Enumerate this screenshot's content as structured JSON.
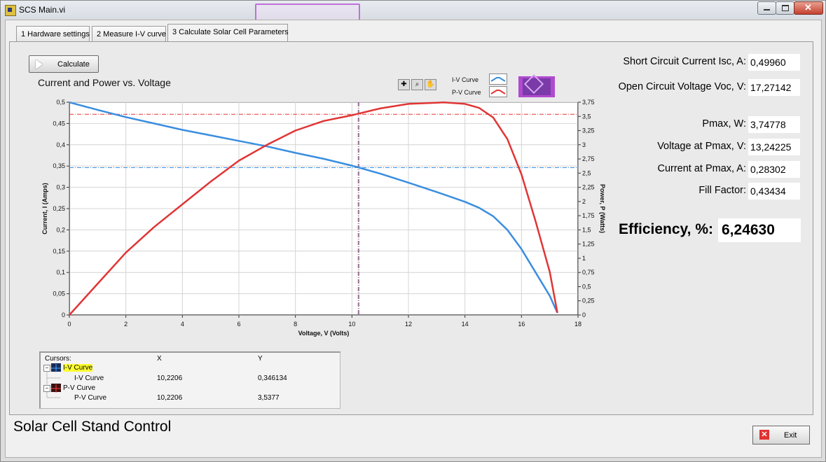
{
  "window": {
    "title": "SCS Main.vi"
  },
  "tabs": [
    {
      "label": "1 Hardware settings"
    },
    {
      "label": "2 Measure I-V curve"
    },
    {
      "label": "3 Calculate Solar Cell Parameters"
    }
  ],
  "toolbar": {
    "calculate_label": "Calculate"
  },
  "graph": {
    "title": "Current and Power vs. Voltage",
    "legend": [
      {
        "name": "I-V Curve",
        "color": "#3a8ee0"
      },
      {
        "name": "P-V Curve",
        "color": "#e03535"
      }
    ]
  },
  "indicators": [
    {
      "label": "Short Circuit Current Isc, A:",
      "value": "0,49960"
    },
    {
      "label": "Open Circuit Voltage Voc, V:",
      "value": "17,27142"
    },
    {
      "label": "Pmax, W:",
      "value": "3,74778"
    },
    {
      "label": "Voltage at Pmax, V:",
      "value": "13,24225"
    },
    {
      "label": "Current at Pmax, A:",
      "value": "0,28302"
    },
    {
      "label": "Fill Factor:",
      "value": "0,43434"
    }
  ],
  "efficiency": {
    "label": "Efficiency, %:",
    "value": "6,24630"
  },
  "cursors": {
    "header": {
      "name": "Cursors:",
      "x": "X",
      "y": "Y"
    },
    "groups": [
      {
        "name": "I-V Curve",
        "child": "I-V Curve",
        "x": "10,2206",
        "y": "0,346134",
        "color": "#1a5cc8"
      },
      {
        "name": "P-V Curve",
        "child": "P-V Curve",
        "x": "10,2206",
        "y": "3,5377",
        "color": "#c81a1a"
      }
    ]
  },
  "footer": {
    "title": "Solar Cell Stand Control",
    "exit_label": "Exit"
  },
  "chart_data": {
    "type": "line",
    "title": "Current and Power vs. Voltage",
    "xlabel": "Voltage, V (Volts)",
    "ylabel": "Current, I (Amps)",
    "y2label": "Power, P (Watts)",
    "xlim": [
      0,
      18
    ],
    "ylim": [
      0,
      0.5
    ],
    "y2lim": [
      0,
      3.75
    ],
    "xticks": [
      "0",
      "2",
      "4",
      "6",
      "8",
      "10",
      "12",
      "14",
      "16",
      "18"
    ],
    "yticks": [
      "0",
      "0,05",
      "0,1",
      "0,15",
      "0,2",
      "0,25",
      "0,3",
      "0,35",
      "0,4",
      "0,45",
      "0,5"
    ],
    "y2ticks": [
      "0",
      "0,25",
      "0,5",
      "0,75",
      "1",
      "1,25",
      "1,5",
      "1,75",
      "2",
      "2,25",
      "2,5",
      "2,75",
      "3",
      "3,25",
      "3,5",
      "3,75"
    ],
    "grid": true,
    "series": [
      {
        "name": "I-V Curve",
        "axis": "left",
        "color": "#3a8ee0",
        "x": [
          0,
          1,
          2,
          3,
          4,
          5,
          6,
          7,
          8,
          9,
          10,
          11,
          12,
          13,
          14,
          14.5,
          15,
          15.5,
          16,
          16.5,
          17,
          17.27
        ],
        "y": [
          0.4996,
          0.482,
          0.465,
          0.45,
          0.435,
          0.422,
          0.409,
          0.396,
          0.381,
          0.367,
          0.351,
          0.332,
          0.311,
          0.289,
          0.266,
          0.252,
          0.232,
          0.2,
          0.155,
          0.1,
          0.045,
          0.005
        ]
      },
      {
        "name": "P-V Curve",
        "axis": "right",
        "color": "#e03535",
        "x": [
          0,
          1,
          2,
          3,
          4,
          5,
          6,
          7,
          8,
          9,
          10,
          11,
          12,
          13,
          13.24,
          14,
          14.5,
          15,
          15.5,
          16,
          16.5,
          17,
          17.27
        ],
        "y": [
          0,
          0.55,
          1.1,
          1.55,
          1.95,
          2.35,
          2.72,
          3.0,
          3.25,
          3.42,
          3.52,
          3.64,
          3.72,
          3.74,
          3.748,
          3.72,
          3.65,
          3.48,
          3.1,
          2.48,
          1.65,
          0.76,
          0.04
        ]
      }
    ],
    "cursors": [
      {
        "name": "I-V Curve",
        "x": 10.2206,
        "y": 0.346134
      },
      {
        "name": "P-V Curve",
        "x": 10.2206,
        "y": 3.5377
      }
    ]
  }
}
